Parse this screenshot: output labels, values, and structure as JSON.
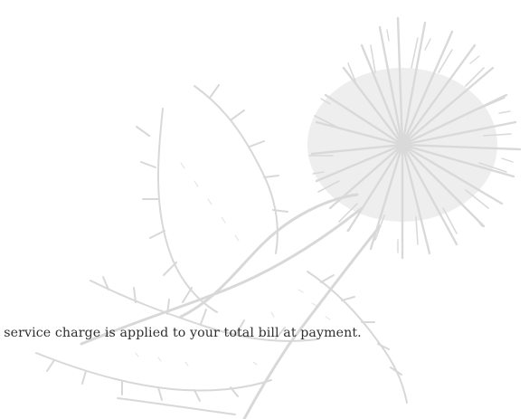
{
  "menu_page": {
    "decoration": {
      "icon": "thistle-illustration-icon",
      "color": "#dcdcdc"
    },
    "footer_note": "% service charge is applied to your total bill at payment."
  }
}
